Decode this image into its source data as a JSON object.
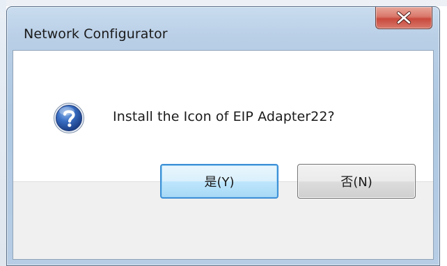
{
  "dialog": {
    "title": "Network Configurator",
    "message": "Install the Icon of EIP Adapter22?",
    "icon": "question-icon",
    "buttons": {
      "yes_label": "是(Y)",
      "no_label": "否(N)"
    },
    "colors": {
      "accent": "#3c8fd6",
      "close_button": "#c94a3d",
      "frame": "#b9cfe6"
    }
  }
}
